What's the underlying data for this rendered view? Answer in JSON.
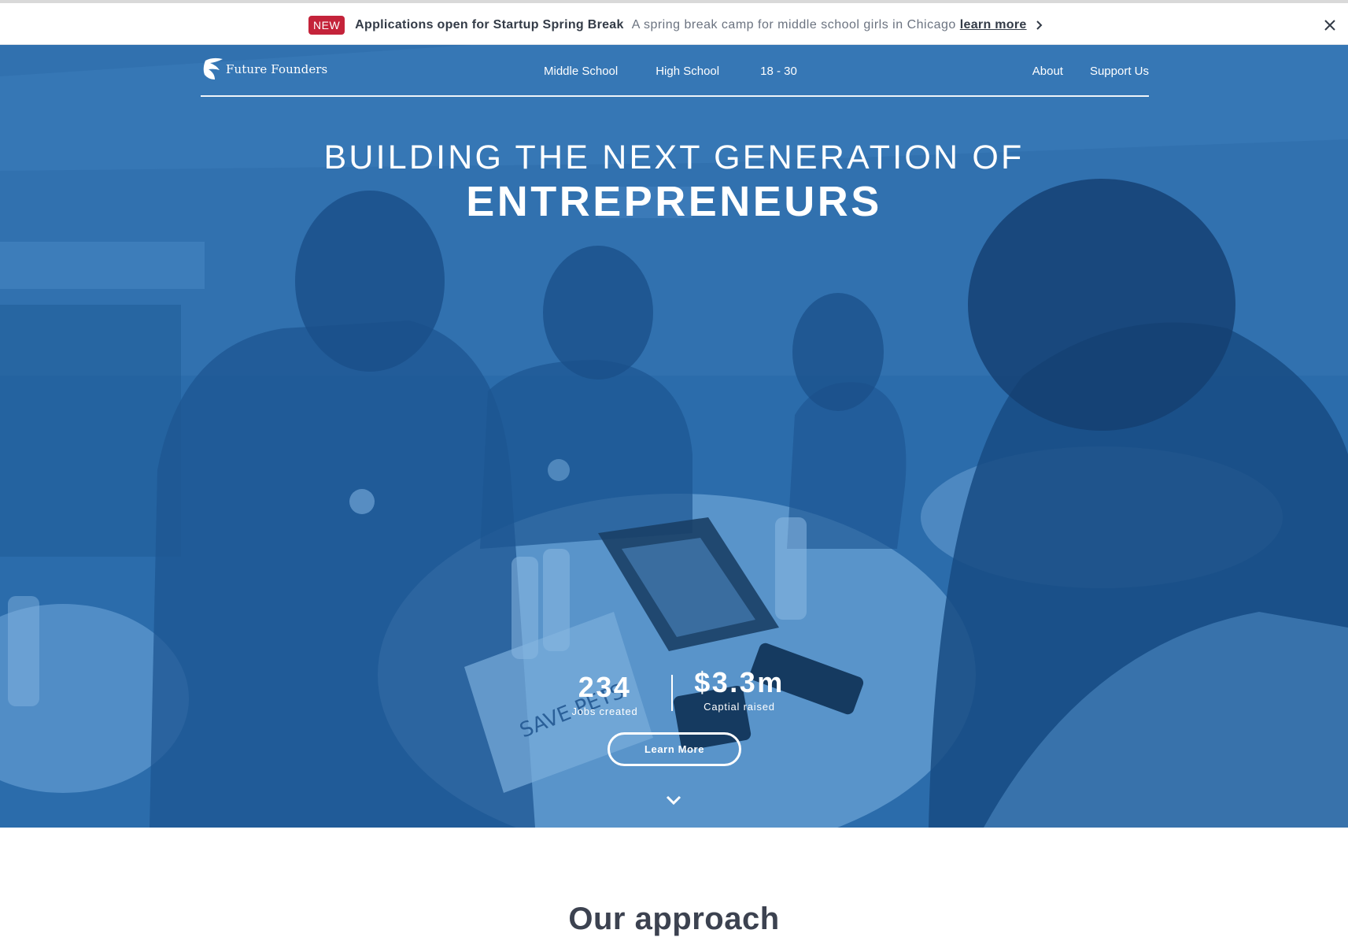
{
  "announcement": {
    "badge": "NEW",
    "title": "Applications open for Startup Spring Break",
    "description": "A spring break camp for middle school girls in Chicago",
    "link_label": "learn more"
  },
  "nav": {
    "logo_text": "Future Founders",
    "center_links": [
      "Middle School",
      "High School",
      "18 - 30"
    ],
    "right_links": [
      "About",
      "Support Us"
    ]
  },
  "hero": {
    "headline_line1": "BUILDING THE NEXT GENERATION OF",
    "headline_line2": "ENTREPRENEURS",
    "photo_sign_text": "SAVE PETS",
    "stats": [
      {
        "value": "234",
        "label": "Jobs created"
      },
      {
        "value": "$3.3m",
        "label": "Captial raised"
      }
    ],
    "cta_label": "Learn More"
  },
  "sections": {
    "approach_title": "Our approach"
  },
  "colors": {
    "hero_overlay": "#2b6cab",
    "badge_red": "#c4233a",
    "text_dark": "#333b47"
  },
  "icons": [
    "future-founders-logo-icon",
    "chevron-right-icon",
    "close-icon",
    "chevron-down-icon"
  ]
}
